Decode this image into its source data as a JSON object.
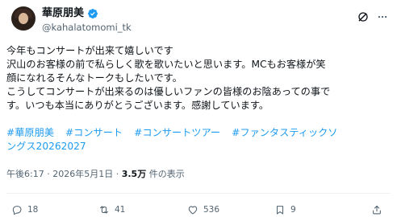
{
  "author": {
    "display_name": "華原朋美",
    "handle": "@kahalatomomi_tk",
    "verified": true,
    "avatar_icon": "profile-photo"
  },
  "header_icons": {
    "grok": "grok-icon",
    "more": "more-icon"
  },
  "tweet": {
    "lines": [
      "今年もコンサートが出来て嬉しいです",
      "沢山のお客様の前で私らしく歌を歌いたいと思います。MCもお客様が笑",
      "顔になれるそんなトークもしたいです。",
      "こうしてコンサートが出来るのは優しいファンの皆様のお陰あっての事で",
      "す。いつも本当にありがとうございます。感謝しています。"
    ],
    "hashtags": [
      "#華原朋美",
      "#コンサート",
      "#コンサートツアー",
      "#ファンタスティックソ",
      "ングス20262027"
    ]
  },
  "meta": {
    "time": "午後6:17",
    "separator": "·",
    "date": "2026年5月1日",
    "views_count": "3.5万",
    "views_label": "件の表示"
  },
  "actions": {
    "reply_count": "18",
    "repost_count": "41",
    "like_count": "536",
    "bookmark_count": "9"
  },
  "colors": {
    "text": "#0f1419",
    "secondary": "#536471",
    "link": "#1d9bf0",
    "verified": "#1d9bf0",
    "divider": "#eff3f4"
  }
}
